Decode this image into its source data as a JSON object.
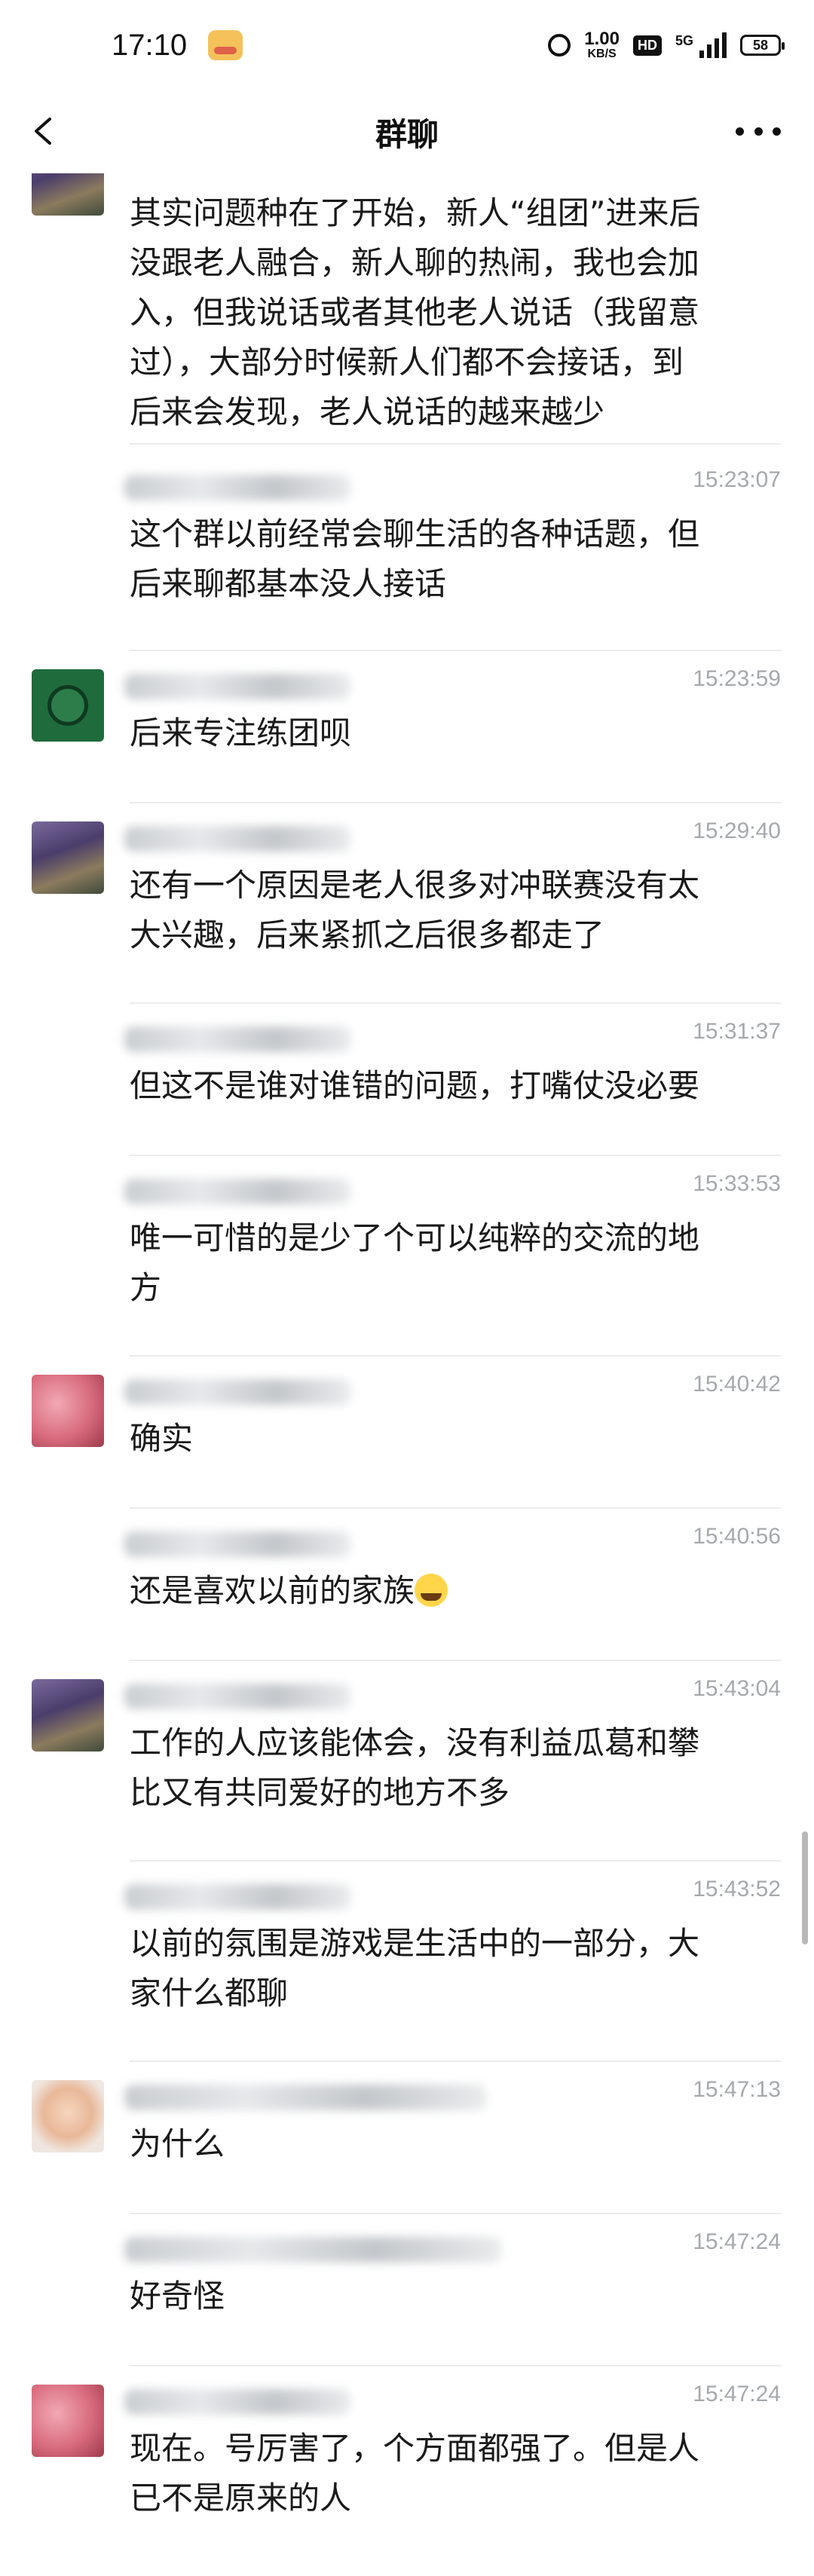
{
  "status_bar": {
    "time": "17:10",
    "speed_value": "1.00",
    "speed_unit": "KB/S",
    "hd": "HD",
    "network": "5G",
    "battery": "58"
  },
  "header": {
    "title": "群聊"
  },
  "messages": [
    {
      "avatar": "purple",
      "timestamp": "",
      "text_lines": [
        "其实问题种在了开始，新人“组团”进来后",
        "没跟老人融合，新人聊的热闹，我也会加",
        "入，但我说话或者其他老人说话（我留意",
        "过），大部分时候新人们都不会接话，到",
        "后来会发现，老人说话的越来越少"
      ]
    },
    {
      "avatar": "",
      "timestamp": "15:23:07",
      "text_lines": [
        "这个群以前经常会聊生活的各种话题，但",
        "后来聊都基本没人接话"
      ]
    },
    {
      "avatar": "green",
      "timestamp": "15:23:59",
      "text_lines": [
        "后来专注练团呗"
      ]
    },
    {
      "avatar": "purple",
      "timestamp": "15:29:40",
      "text_lines": [
        "还有一个原因是老人很多对冲联赛没有太",
        "大兴趣，后来紧抓之后很多都走了"
      ]
    },
    {
      "avatar": "",
      "timestamp": "15:31:37",
      "text_lines": [
        "但这不是谁对谁错的问题，打嘴仗没必要"
      ]
    },
    {
      "avatar": "",
      "timestamp": "15:33:53",
      "text_lines": [
        "唯一可惜的是少了个可以纯粹的交流的地",
        "方"
      ]
    },
    {
      "avatar": "pink",
      "timestamp": "15:40:42",
      "text_lines": [
        "确实"
      ]
    },
    {
      "avatar": "",
      "timestamp": "15:40:56",
      "text_lines": [
        "还是喜欢以前的家族"
      ]
    },
    {
      "avatar": "purple",
      "timestamp": "15:43:04",
      "text_lines": [
        "工作的人应该能体会，没有利益瓜葛和攀",
        "比又有共同爱好的地方不多"
      ]
    },
    {
      "avatar": "",
      "timestamp": "15:43:52",
      "text_lines": [
        "以前的氛围是游戏是生活中的一部分，大",
        "家什么都聊"
      ]
    },
    {
      "avatar": "baby",
      "timestamp": "15:47:13",
      "text_lines": [
        "为什么"
      ]
    },
    {
      "avatar": "",
      "timestamp": "15:47:24",
      "text_lines": [
        "好奇怪"
      ]
    },
    {
      "avatar": "pink",
      "timestamp": "15:47:24",
      "text_lines": [
        "现在。号厉害了，个方面都强了。但是人",
        "已不是原来的人"
      ]
    }
  ]
}
